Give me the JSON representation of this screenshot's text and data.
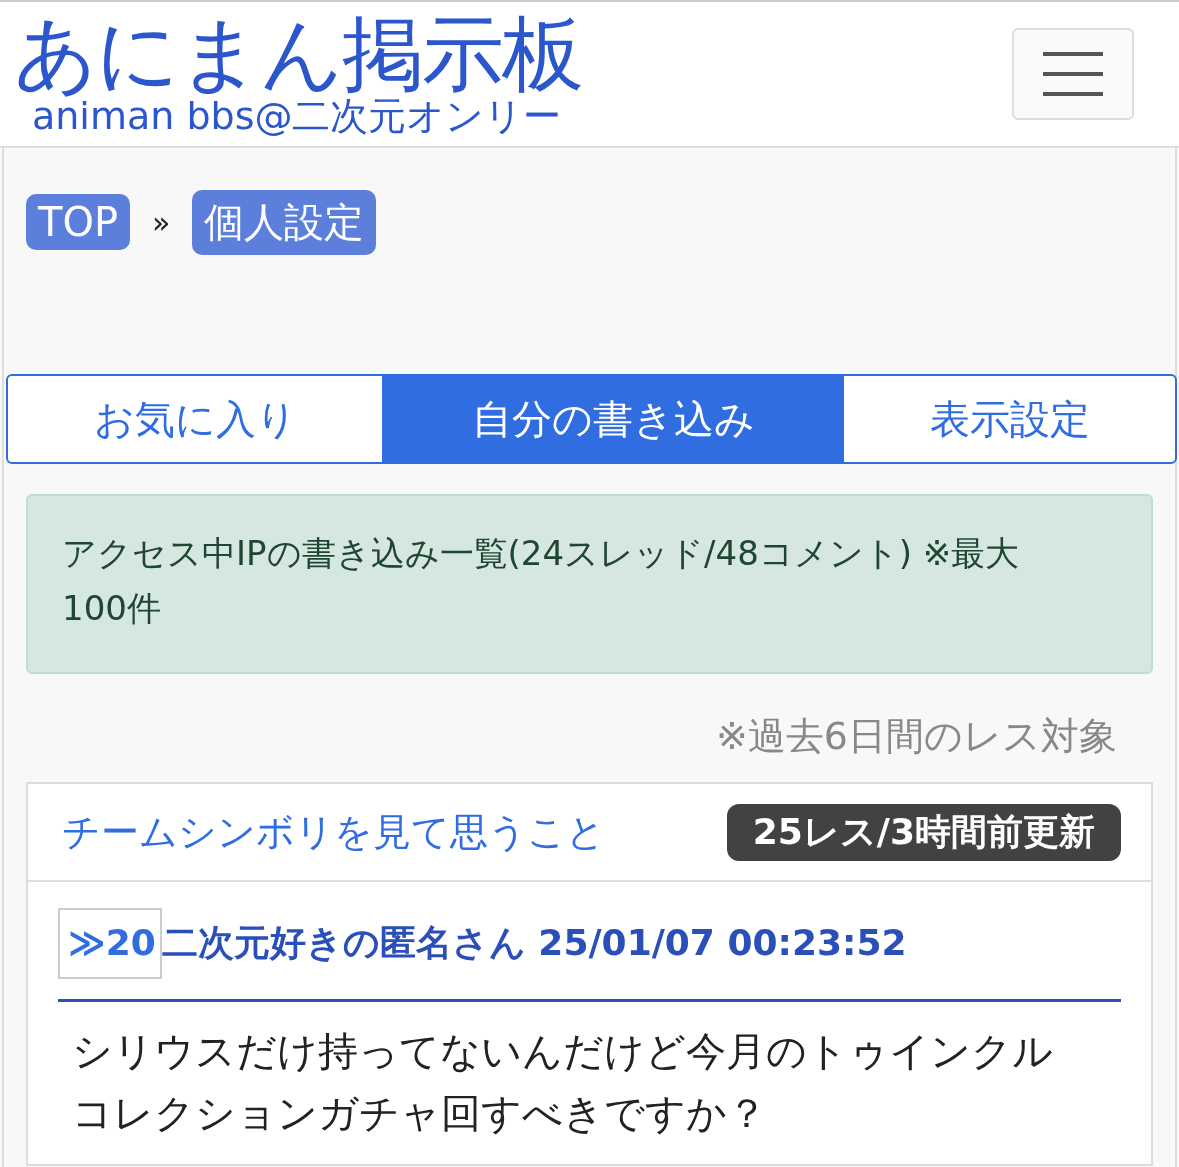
{
  "header": {
    "title": "あにまん掲示板",
    "subtitle": "animan bbs@二次元オンリー"
  },
  "breadcrumb": {
    "items": [
      {
        "label": "TOP"
      },
      {
        "label": "個人設定"
      }
    ],
    "separator": "»"
  },
  "tabs": [
    {
      "label": "お気に入り",
      "selected": false
    },
    {
      "label": "自分の書き込み",
      "selected": true
    },
    {
      "label": "表示設定",
      "selected": false
    }
  ],
  "alert": {
    "text": "アクセス中IPの書き込み一覧(24スレッド/48コメント) ※最大100件"
  },
  "note": "※過去6日間のレス対象",
  "threads": [
    {
      "title": "チームシンボリを見て思うこと",
      "badge": "25レス/3時間前更新",
      "posts": [
        {
          "number": "≫20",
          "meta": "二次元好きの匿名さん 25/01/07 00:23:52",
          "body": "シリウスだけ持ってないんだけど今月のトゥインクルコレクションガチャ回すべきですか？"
        }
      ]
    }
  ]
}
